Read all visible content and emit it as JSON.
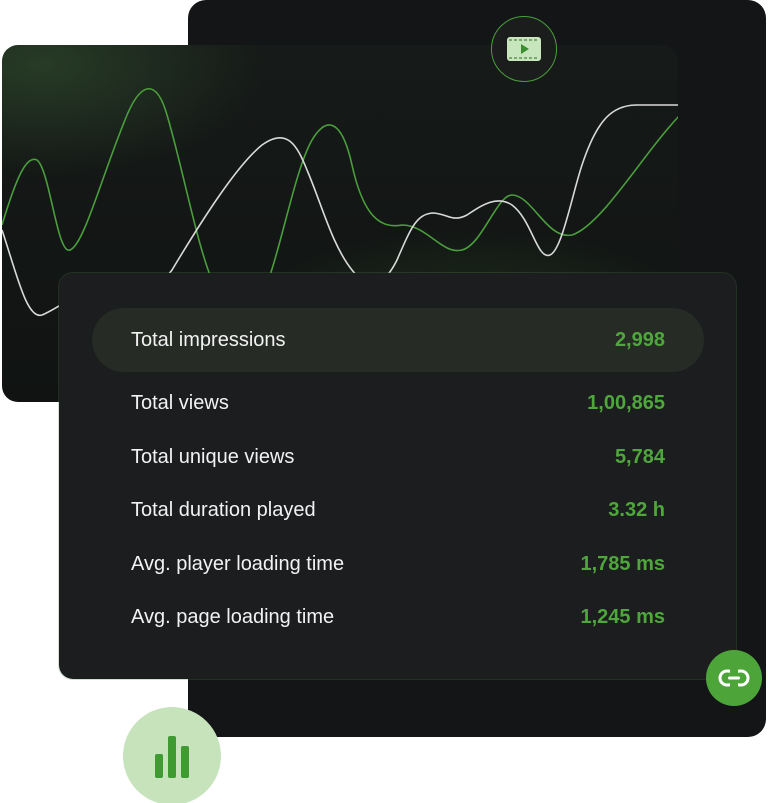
{
  "colors": {
    "accent": "#4fa63c",
    "panel_dark": "#141517",
    "card": "#1c1d1f",
    "highlight_row": "#262b26",
    "badge_light": "#c6e3bc",
    "line_green": "#4a9e3c",
    "line_white": "#d9d9d9"
  },
  "icons": {
    "video": "video-play-icon",
    "link": "link-icon",
    "bars": "bar-chart-icon"
  },
  "stats": [
    {
      "label": "Total impressions",
      "value": "2,998",
      "highlighted": true
    },
    {
      "label": "Total views",
      "value": "1,00,865",
      "highlighted": false
    },
    {
      "label": "Total unique views",
      "value": "5,784",
      "highlighted": false
    },
    {
      "label": "Total duration played",
      "value": "3.32 h",
      "highlighted": false
    },
    {
      "label": "Avg. player loading time",
      "value": "1,785 ms",
      "highlighted": false
    },
    {
      "label": "Avg. page loading time",
      "value": "1,245 ms",
      "highlighted": false
    }
  ]
}
